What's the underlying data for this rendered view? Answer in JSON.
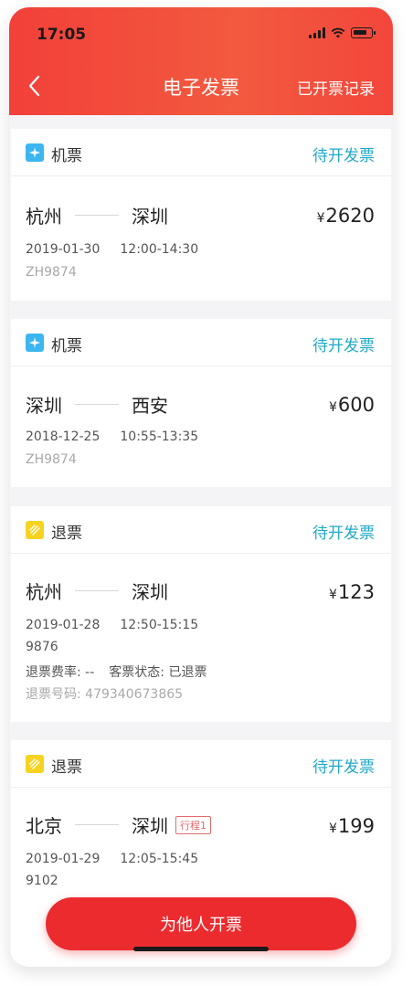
{
  "status": {
    "time": "17:05"
  },
  "nav": {
    "title": "电子发票",
    "right": "已开票记录"
  },
  "cards": [
    {
      "type": "机票",
      "action": "待开发票",
      "from": "杭州",
      "to": "深圳",
      "price": "2620",
      "currency": "¥",
      "date": "2019-01-30",
      "time": "12:00-14:30",
      "flight": "ZH9874"
    },
    {
      "type": "机票",
      "action": "待开发票",
      "from": "深圳",
      "to": "西安",
      "price": "600",
      "currency": "¥",
      "date": "2018-12-25",
      "time": "10:55-13:35",
      "flight": "ZH9874"
    },
    {
      "type": "退票",
      "action": "待开发票",
      "from": "杭州",
      "to": "深圳",
      "price": "123",
      "currency": "¥",
      "date": "2019-01-28",
      "time": "12:50-15:15",
      "flight": "9876",
      "fee_rate": "退票费率: --",
      "status_text": "客票状态: 已退票",
      "refund_no": "退票号码: 479340673865"
    },
    {
      "type": "退票",
      "action": "待开发票",
      "from": "北京",
      "to": "深圳",
      "tag": "行程1",
      "price": "199",
      "currency": "¥",
      "date": "2019-01-29",
      "time": "12:05-15:45",
      "flight": "9102"
    }
  ],
  "cta": "为他人开票"
}
